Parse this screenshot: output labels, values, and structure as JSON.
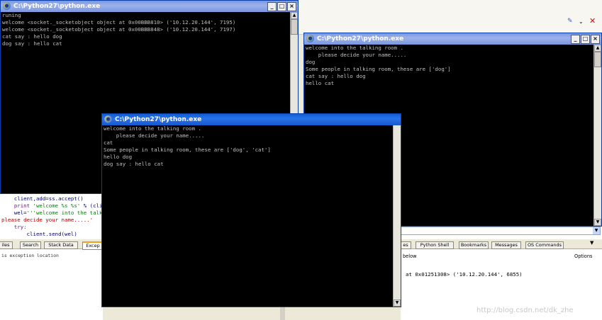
{
  "windows": [
    {
      "title": "C:\\Python27\\python.exe",
      "state": "inactive",
      "lines": [
        "runing",
        "welcome <socket._socketobject object at 0x00BBB810> ('10.12.20.144', 7195)",
        "welcome <socket._socketobject object at 0x00BBB848> ('10.12.20.144', 7197)",
        "cat say : hello dog",
        "dog say : hello cat"
      ]
    },
    {
      "title": "C:\\Python27\\python.exe",
      "state": "inactive",
      "lines": [
        "welcome into the talking room .",
        "    please decide your name.....",
        "dog",
        "Some people in talking room, these are ['dog']",
        "cat say : hello dog",
        "hello cat"
      ]
    },
    {
      "title": "C:\\Python27\\python.exe",
      "state": "active",
      "lines": [
        "welcome into the talking room .",
        "    please decide your name.....",
        "cat",
        "Some people in talking room, these are ['dog', 'cat']",
        "hello dog",
        "dog say : hello cat"
      ]
    }
  ],
  "editor": {
    "lines": [
      {
        "indent": "    ",
        "parts": [
          {
            "t": "client,add=ss.accept()",
            "c": ""
          }
        ]
      },
      {
        "indent": "    ",
        "parts": [
          {
            "t": "print ",
            "c": "kw"
          },
          {
            "t": "'welcome %s %s'",
            "c": "str"
          },
          {
            "t": " % (clien",
            "c": ""
          }
        ]
      },
      {
        "indent": "    ",
        "parts": [
          {
            "t": "wel=",
            "c": ""
          },
          {
            "t": "'''welcome into the talkin",
            "c": "str"
          }
        ]
      },
      {
        "indent": "",
        "parts": [
          {
            "t": "please decide your name.....'",
            "c": "red"
          }
        ]
      },
      {
        "indent": "    ",
        "parts": [
          {
            "t": "try:",
            "c": "kw"
          }
        ]
      },
      {
        "indent": "        ",
        "parts": [
          {
            "t": "client.send(wel)",
            "c": ""
          }
        ]
      }
    ],
    "tabs_left": [
      "iles",
      "Search",
      "Stack Data",
      "Excep"
    ],
    "left_panel_text": "is exception location"
  },
  "ide_right": {
    "tabs": [
      "es",
      "Python Shell",
      "Bookmarks",
      "Messages",
      "OS Commands"
    ],
    "panel_label": "below",
    "options_label": "Options",
    "output_line": "at 0x01251308> ('10.12.20.144', 6855)"
  },
  "watermark": "http://blog.csdn.net/dk_zhe",
  "controls": {
    "minimize": "_",
    "maximize": "□",
    "close": "×"
  }
}
